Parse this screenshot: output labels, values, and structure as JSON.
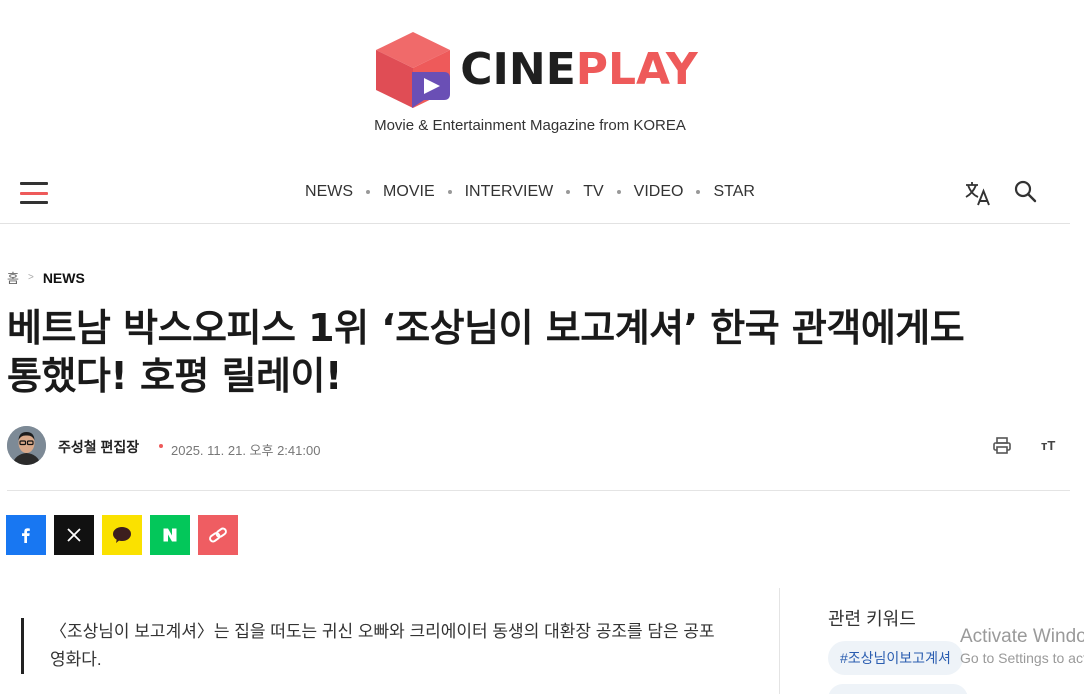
{
  "brand": {
    "logo_part1": "CINE",
    "logo_part2": "PLAY",
    "tagline": "Movie & Entertainment Magazine from KOREA",
    "colors": {
      "accent": "#ee5a5a",
      "dark": "#1f1f1f"
    }
  },
  "nav": {
    "items": [
      "NEWS",
      "MOVIE",
      "INTERVIEW",
      "TV",
      "VIDEO",
      "STAR"
    ],
    "icons": {
      "menu": "hamburger-menu-icon",
      "translate": "translate-icon",
      "search": "search-icon"
    }
  },
  "breadcrumb": {
    "home": "홈",
    "current": "NEWS"
  },
  "article": {
    "title": "베트남 박스오피스 1위 ‘조상님이 보고계셔’ 한국 관객에게도 통했다! 호평 릴레이!",
    "author": "주성철 편집장",
    "date": "2025. 11. 21. 오후 2:41:00",
    "font_size_label": "ᴛT",
    "lead": "〈조상님이 보고계셔〉는 집을 떠도는 귀신 오빠와 크리에이터 동생의 대환장 공조를 담은 공포영화다."
  },
  "share": {
    "buttons": [
      "facebook",
      "x",
      "kakaotalk",
      "naver",
      "copy-link"
    ]
  },
  "sidebar": {
    "keywords_title": "관련 키워드",
    "keywords": [
      "#조상님이보고계셔"
    ]
  },
  "watermark": {
    "line1": "Activate Windows",
    "line2": "Go to Settings to activate Windows."
  }
}
